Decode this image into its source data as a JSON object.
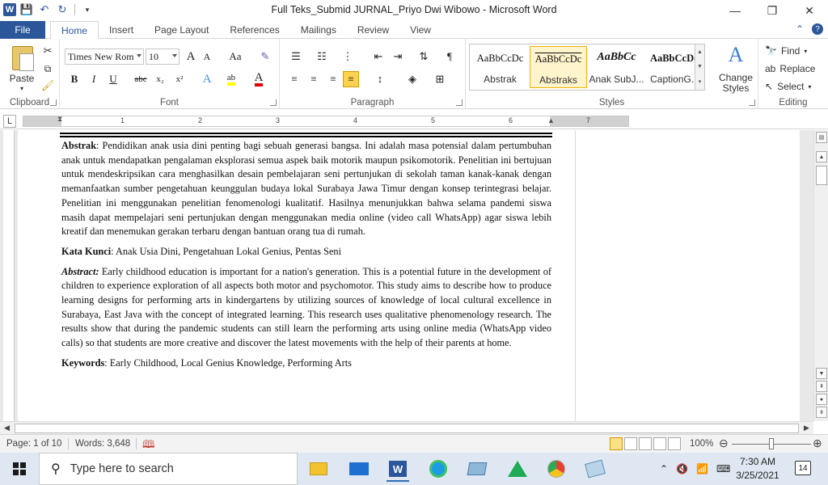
{
  "window": {
    "title": "Full Teks_Submid JURNAL_Priyo Dwi Wibowo  -  Microsoft Word",
    "app_letter": "W"
  },
  "tabs": {
    "file": "File",
    "items": [
      "Home",
      "Insert",
      "Page Layout",
      "References",
      "Mailings",
      "Review",
      "View"
    ],
    "active": "Home"
  },
  "ribbon": {
    "clipboard": {
      "label": "Clipboard",
      "paste": "Paste"
    },
    "font": {
      "label": "Font",
      "font_name": "Times New Rom",
      "font_size": "10",
      "grow": "A",
      "shrink": "A",
      "change_case": "Aa",
      "bold": "B",
      "italic": "I",
      "underline": "U",
      "strikethrough": "abc",
      "subscript": "x₂",
      "superscript": "x²",
      "highlight_color": "#ffff00",
      "font_color": "#e00000"
    },
    "paragraph": {
      "label": "Paragraph",
      "shading_color": "#ffd34d"
    },
    "styles": {
      "label": "Styles",
      "items": [
        {
          "preview": "AaBbCcDc",
          "name": "Abstrak"
        },
        {
          "preview": "AaBbCcDc",
          "name": "Abstraks"
        },
        {
          "preview": "AaBbCc",
          "name": "Anak SubJ..."
        },
        {
          "preview": "AaBbCcDd",
          "name": "CaptionG..."
        }
      ],
      "selected_index": 1,
      "change_styles": "Change Styles"
    },
    "editing": {
      "label": "Editing",
      "find": "Find",
      "replace": "Replace",
      "select": "Select"
    }
  },
  "ruler": {
    "numbers": [
      "1",
      "1",
      "2",
      "3",
      "4",
      "5",
      "6",
      "7"
    ]
  },
  "document": {
    "abstrak_label": "Abstrak",
    "abstrak_text": ": Pendidikan anak usia dini penting bagi sebuah generasi bangsa. Ini adalah masa potensial dalam pertumbuhan anak untuk mendapatkan pengalaman eksplorasi semua aspek baik motorik maupun psikomotorik. Penelitian ini bertujuan untuk mendeskripsikan cara menghasilkan desain pembelajaran seni pertunjukan di sekolah taman kanak-kanak dengan memanfaatkan sumber pengetahuan keunggulan budaya lokal Surabaya Jawa Timur dengan konsep terintegrasi belajar. Penelitian ini menggunakan penelitian fenomenologi kualitatif. Hasilnya menunjukkan bahwa selama pandemi siswa masih dapat mempelajari seni pertunjukan dengan menggunakan media online (video call WhatsApp) agar siswa lebih kreatif dan menemukan gerakan terbaru dengan bantuan orang tua di rumah.",
    "kata_kunci_label": "Kata Kunci",
    "kata_kunci_text": ":  Anak Usia Dini,  Pengetahuan Lokal Genius, Pentas Seni",
    "abstract_label": "Abstract:",
    "abstract_text": " Early childhood education is important for a nation's generation. This is a potential future in the development of children to experience exploration of all aspects both motor and psychomotor. This study aims to describe how to produce learning designs for performing arts in kindergartens by utilizing sources of knowledge of local cultural excellence in Surabaya, East Java with the concept of integrated learning. This research uses qualitative phenomenology research. The results show that during the pandemic students can still learn the performing arts using online media (WhatsApp video calls) so that students are more creative and discover the latest movements with the help of their parents at home.",
    "keywords_label": "Keywords",
    "keywords_text": ": Early Childhood, Local Genius Knowledge,  Performing Arts"
  },
  "status": {
    "page": "Page: 1 of 10",
    "words": "Words: 3,648",
    "zoom": "100%"
  },
  "taskbar": {
    "search_placeholder": "Type here to search",
    "time": "7:30 AM",
    "date": "3/25/2021",
    "notifications": "14"
  }
}
